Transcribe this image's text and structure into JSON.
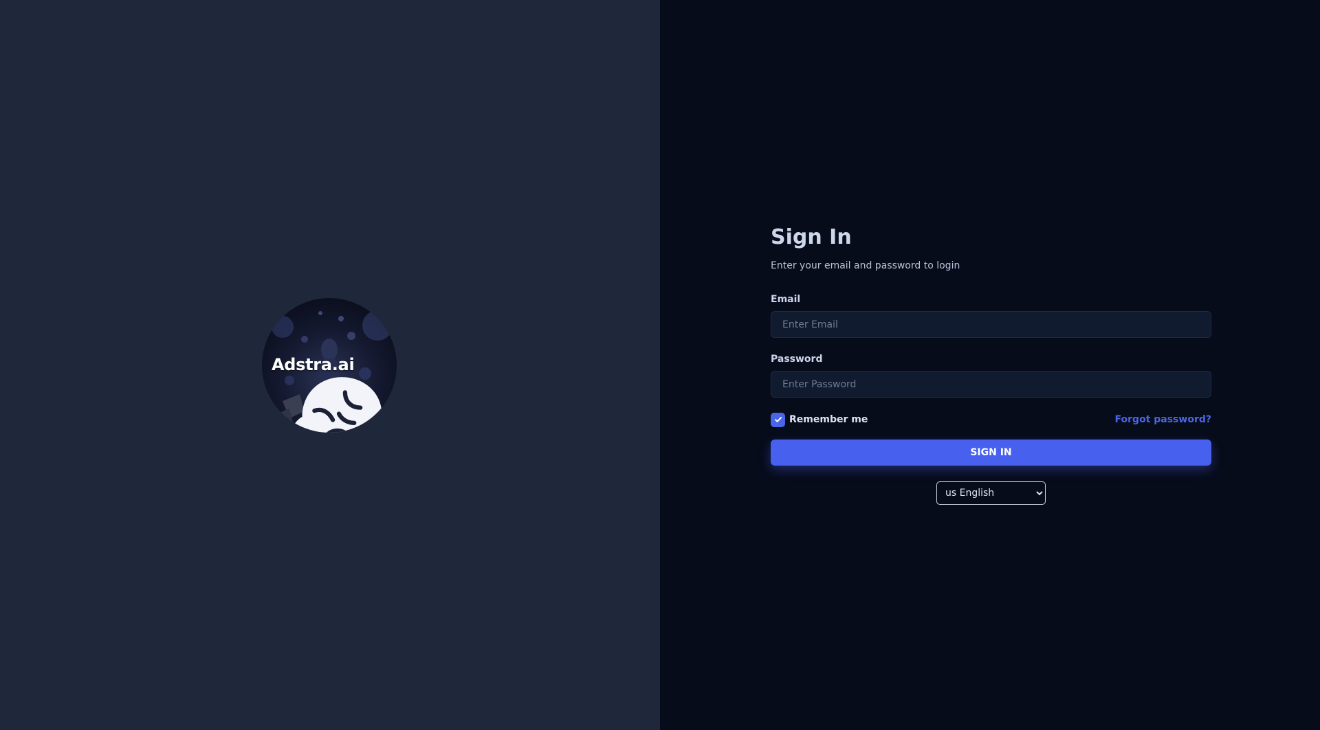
{
  "brand": {
    "name": "Adstra.ai",
    "logo_icon": "brain-icon"
  },
  "signin": {
    "title": "Sign In",
    "subtitle": "Enter your email and password to login",
    "email_label": "Email",
    "email_placeholder": "Enter Email",
    "email_value": "",
    "password_label": "Password",
    "password_placeholder": "Enter Password",
    "password_value": "",
    "remember_label": "Remember me",
    "remember_checked": true,
    "forgot_label": "Forgot password?",
    "submit_label": "SIGN IN"
  },
  "language": {
    "selected": "us English"
  },
  "colors": {
    "left_panel_bg": "#1f283a",
    "right_panel_bg": "#070c1b",
    "accent": "#4760ee",
    "input_bg": "#111b30",
    "heading_text": "#cdd6ea"
  }
}
